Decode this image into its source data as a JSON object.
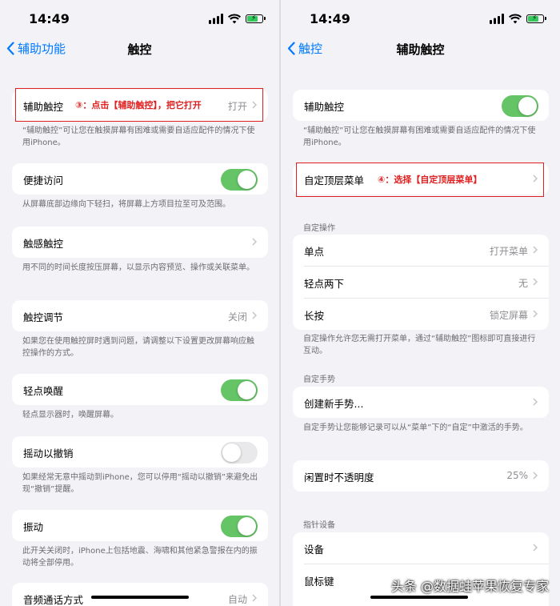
{
  "left": {
    "status": {
      "time": "14:49"
    },
    "nav": {
      "back_label": "辅助功能",
      "title": "触控"
    },
    "assistive_touch": {
      "label": "辅助触控",
      "value": "打开",
      "note": "③：点击【辅助触控】，把它打开"
    },
    "assistive_touch_footer": "“辅助触控”可让您在触摸屏幕有困难或需要自适应配件的情况下使用iPhone。",
    "reachability": {
      "label": "便捷访问",
      "on": true
    },
    "reachability_footer": "从屏幕底部边缘向下轻扫，将屏幕上方项目拉至可及范围。",
    "haptic_touch": {
      "label": "触感触控"
    },
    "haptic_touch_footer": "用不同的时间长度按压屏幕，以显示内容预览、操作或关联菜单。",
    "touch_accommodations": {
      "label": "触控调节",
      "value": "关闭"
    },
    "touch_accommodations_footer": "如果您在使用触控屏时遇到问题，请调整以下设置更改屏幕响应触控操作的方式。",
    "tap_to_wake": {
      "label": "轻点唤醒",
      "on": true
    },
    "tap_to_wake_footer": "轻点显示器时，唤醒屏幕。",
    "shake_to_undo": {
      "label": "摇动以撤销",
      "on": false
    },
    "shake_to_undo_footer": "如果经常无意中摇动到iPhone，您可以停用“摇动以撤销”来避免出现“撤销”提醒。",
    "vibration": {
      "label": "振动",
      "on": true
    },
    "vibration_footer": "此开关关闭时，iPhone上包括地震、海啸和其他紧急警报在内的振动将全部停用。",
    "call_audio": {
      "label": "音频通话方式",
      "value": "自动"
    }
  },
  "right": {
    "status": {
      "time": "14:49"
    },
    "nav": {
      "back_label": "触控",
      "title": "辅助触控"
    },
    "assistive_touch": {
      "label": "辅助触控",
      "on": true
    },
    "assistive_touch_footer": "“辅助触控”可让您在触摸屏幕有困难或需要自适应配件的情况下使用iPhone。",
    "customize_menu": {
      "label": "自定顶层菜单",
      "note": "④：选择【自定顶层菜单】"
    },
    "custom_actions_header": "自定操作",
    "custom_actions": [
      {
        "label": "单点",
        "value": "打开菜单"
      },
      {
        "label": "轻点两下",
        "value": "无"
      },
      {
        "label": "长按",
        "value": "锁定屏幕"
      }
    ],
    "custom_actions_footer": "自定操作允许您无需打开菜单，通过“辅助触控”图标即可直接进行互动。",
    "custom_gestures_header": "自定手势",
    "create_gesture": {
      "label": "创建新手势..."
    },
    "custom_gestures_footer": "自定手势让您能够记录可以从“菜单”下的“自定”中激活的手势。",
    "idle_opacity": {
      "label": "闲置时不透明度",
      "value": "25%"
    },
    "pointer_header": "指针设备",
    "pointer_items": [
      {
        "label": "设备"
      },
      {
        "label": "鼠标键"
      }
    ]
  },
  "watermark": "头条 @数据蛙苹果恢复专家",
  "colors": {
    "accent": "#007aff",
    "toggle_on": "#65c466",
    "annotation": "#e02020",
    "background": "#f2f2f7"
  },
  "icons": [
    "signal-icon",
    "wifi-icon",
    "battery-icon",
    "back-chevron-icon",
    "chevron-right-icon"
  ]
}
